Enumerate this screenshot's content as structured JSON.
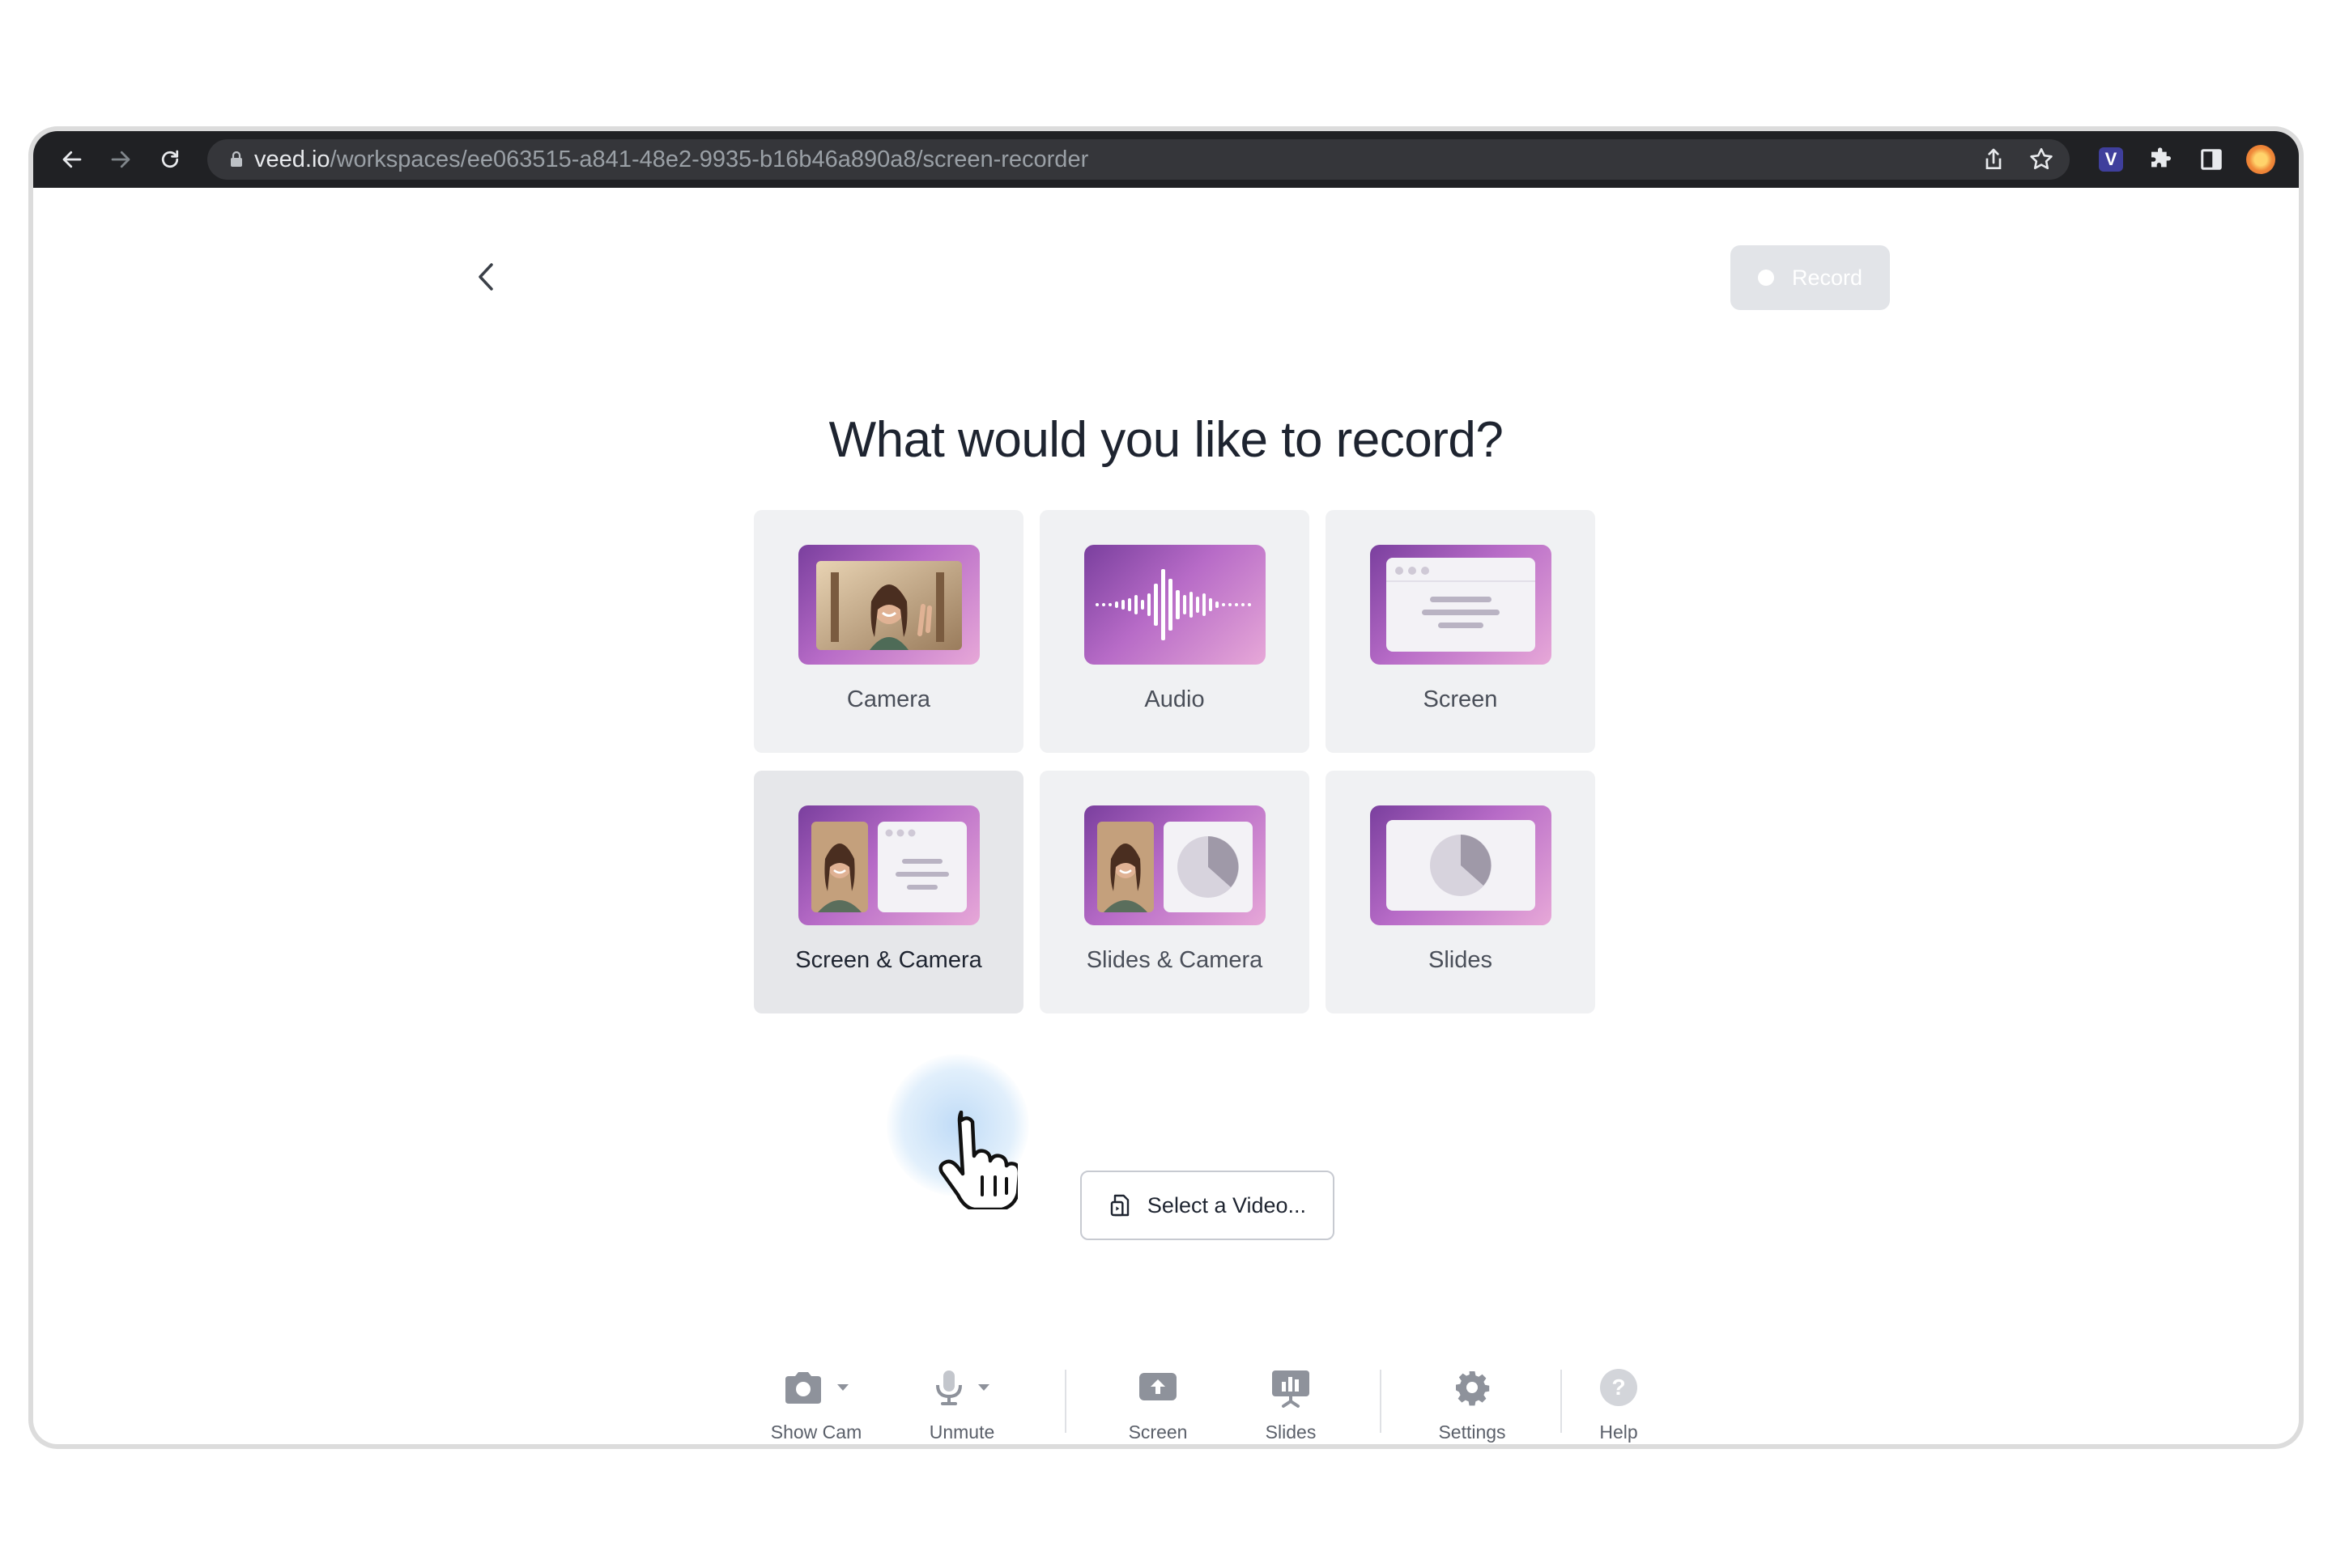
{
  "browser": {
    "url_host": "veed.io",
    "url_path": "/workspaces/ee063515-a841-48e2-9935-b16b46a890a8/screen-recorder",
    "icons": [
      "back-arrow-icon",
      "forward-arrow-icon",
      "reload-icon",
      "lock-icon",
      "share-icon",
      "star-icon",
      "veed-extension-icon",
      "puzzle-icon",
      "sidebar-icon",
      "profile-avatar",
      "kebab-menu-icon"
    ],
    "extension_letter": "V"
  },
  "header": {
    "record_label": "Record"
  },
  "main": {
    "heading": "What would you like to record?",
    "options": [
      {
        "label": "Camera"
      },
      {
        "label": "Audio"
      },
      {
        "label": "Screen"
      },
      {
        "label": "Screen & Camera"
      },
      {
        "label": "Slides & Camera"
      },
      {
        "label": "Slides"
      }
    ],
    "select_video_label": "Select a Video..."
  },
  "toolbar": {
    "show_cam": "Show Cam",
    "unmute": "Unmute",
    "screen": "Screen",
    "slides": "Slides",
    "settings": "Settings",
    "help": "Help"
  },
  "colors": {
    "chrome_bg": "#202124",
    "omnibox_bg": "#35363a",
    "tile_bg": "#f0f1f3",
    "thumb_gradient_start": "#7a3f9e",
    "thumb_gradient_end": "#e7a8d8",
    "record_disabled": "#e2e4e8",
    "heading_text": "#1e2430"
  }
}
